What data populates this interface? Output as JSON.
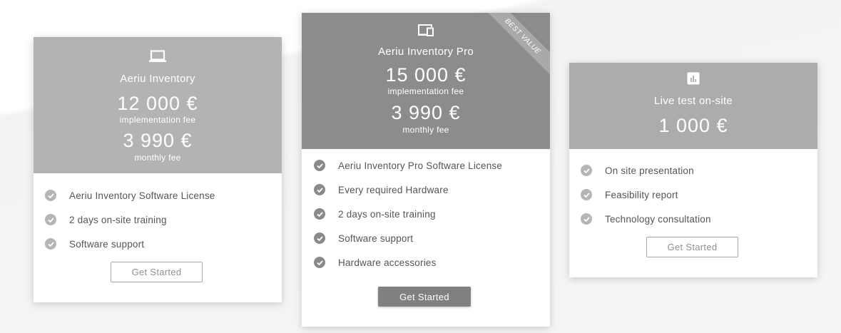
{
  "colors": {
    "header_left": "#b3b3b3",
    "header_middle": "#8c8c8c",
    "header_right": "#acacac",
    "check": "#b5b5b5",
    "button_solid": "#808080"
  },
  "cards": [
    {
      "icon": "laptop-icon",
      "name": "Aeriu Inventory",
      "price": "12 000 €",
      "price_sub": "implementation fee",
      "monthly": "3 990 €",
      "monthly_sub": "monthly fee",
      "features": [
        "Aeriu Inventory Software License",
        "2 days on-site training",
        "Software support"
      ],
      "button": "Get Started"
    },
    {
      "icon": "devices-icon",
      "ribbon": "BEST VALUE",
      "name": "Aeriu Inventory Pro",
      "price": "15 000 €",
      "price_sub": "implementation fee",
      "monthly": "3 990 €",
      "monthly_sub": "monthly fee",
      "features": [
        "Aeriu Inventory Pro Software License",
        "Every required Hardware",
        "2 days on-site training",
        "Software support",
        "Hardware accessories"
      ],
      "button": "Get Started"
    },
    {
      "icon": "bar-chart-icon",
      "name": "Live test on-site",
      "price": "1 000 €",
      "features": [
        "On site presentation",
        "Feasibility report",
        "Technology consultation"
      ],
      "button": "Get Started"
    }
  ]
}
